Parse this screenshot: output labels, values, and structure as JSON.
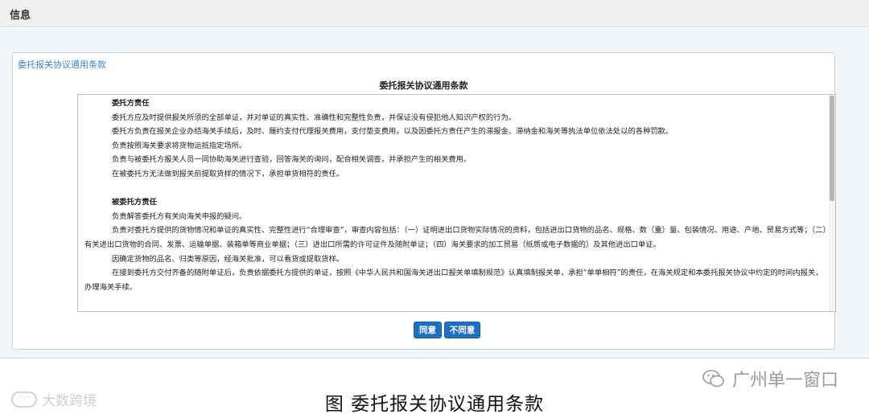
{
  "header": {
    "title": "信息"
  },
  "panel": {
    "title": "委托报关协议通用条款",
    "doc_title": "委托报关协议通用条款"
  },
  "terms": {
    "section1": {
      "heading": "委托方责任",
      "lines": [
        "委托方应及时提供报关所须的全部单证，并对单证的真实性、准确性和完整性负责，并保证没有侵犯他人知识产权的行为。",
        "委托方负责在报关企业办结海关手续后，及时、履约支付代理报关费用，支付垫支费用，以及因委托方责任产生的滞报金、滞纳金和海关等执法单位依法处以的各种罚款。",
        "负责按照海关要求将货物运抵指定场所。",
        "负责与被委托方报关人员一同协助海关进行查验，回答海关的询问，配合相关调查，并承担产生的相关费用。",
        "在被委托方无法做到报关前提取货样的情况下，承担单货相符的责任。"
      ]
    },
    "section2": {
      "heading": "被委托方责任",
      "lines": [
        "负责解答委托方有关向海关申报的疑问。",
        "负责对委托方提供的货物情况和单证的真实性、完整性进行“合理审查”，审查内容包括：（一）证明进出口货物实际情况的资料，包括进出口货物的品名、规格、数（重）量、包装情况、用途、产地、贸易方式等；（二）有关进出口货物的合同、发票、运输单据、装箱单等商业单据；（三）进出口所需的许可证件及随附单证；（四）海关要求的加工贸易（纸质或电子数据的）及其他进出口单证。",
        "因确定货物的品名、归类等原因，经海关批准，可以看货或提取货样。",
        "在接到委托方交付齐备的随附单证后，负责依据委托方提供的单证，按照《中华人民共和国海关进出口报关单填制规范》认真填制报关单，承担“单单相符”的责任，在海关规定和本委托报关协议中约定的时间内报关，办理海关手续。"
      ]
    }
  },
  "buttons": {
    "agree": "同意",
    "disagree": "不同意"
  },
  "caption": "图 委托报关协议通用条款",
  "watermarks": {
    "left": "大数跨境",
    "right": "广州单一窗口"
  },
  "colors": {
    "button": "#1f6fc5",
    "panel_title": "#3a86c8",
    "body_bg": "#f2f6fa"
  }
}
